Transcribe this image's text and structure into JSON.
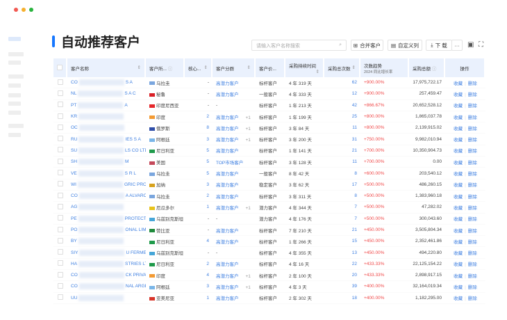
{
  "window": {
    "dots": [
      "#f25a52",
      "#f5b02e",
      "#29b33e"
    ]
  },
  "title": "自动推荐客户",
  "accent": "#1677ff",
  "toolbar": {
    "search_placeholder": "请输入客户名称搜索",
    "merge": "合并客户",
    "custom_cols": "自定义列",
    "download": "下 载",
    "more": "···",
    "icons": [
      "search-icon",
      "merge-icon",
      "columns-icon",
      "download-icon",
      "clipboard-icon",
      "fullscreen-icon"
    ]
  },
  "columns": [
    "客户名称",
    "客户所...",
    "核心...",
    "客户分群",
    "客户价...",
    "采购持续时间",
    "采购总次数",
    "次数趋势",
    "2024 同比增长率",
    "采购总额",
    "操作"
  ],
  "actions": {
    "fav": "收藏",
    "del": "删除"
  },
  "rows": [
    {
      "p": "CO",
      "s": "S A",
      "country": "乌拉圭",
      "flag": "#7aa6de",
      "core": "-",
      "group": "高潜力客户",
      "extra": "",
      "value": "标杆客户",
      "dur": "4 年 319 天",
      "cnt": "62",
      "trend": "+900.00%",
      "amt": "17,975,722.17"
    },
    {
      "p": "NL",
      "s": "S A C",
      "country": "秘鲁",
      "flag": "#d91f26",
      "core": "-",
      "group": "高潜力客户",
      "extra": "",
      "value": "一般客户",
      "dur": "4 年 333 天",
      "cnt": "12",
      "trend": "+900.00%",
      "amt": "257,459.47"
    },
    {
      "p": "PT",
      "s": "A",
      "country": "印度尼西亚",
      "flag": "#e5262a",
      "core": "-",
      "group": "-",
      "extra": "",
      "value": "标杆客户",
      "dur": "1 年 213 天",
      "cnt": "42",
      "trend": "+866.67%",
      "amt": "20,652,528.12"
    },
    {
      "p": "KR",
      "s": "",
      "country": "印度",
      "flag": "#f39a33",
      "core": "2",
      "group": "高潜力客户",
      "extra": "+1",
      "value": "标杆客户",
      "dur": "1 年 199 天",
      "cnt": "25",
      "trend": "+800.00%",
      "amt": "1,865,037.78"
    },
    {
      "p": "OC",
      "s": "",
      "country": "俄罗斯",
      "flag": "#2f4ea8",
      "core": "8",
      "group": "高潜力客户",
      "extra": "+1",
      "value": "标杆客户",
      "dur": "3 年 84 天",
      "cnt": "11",
      "trend": "+800.00%",
      "amt": "2,139,915.02"
    },
    {
      "p": "RU",
      "s": "IES S A",
      "country": "阿根廷",
      "flag": "#7ab6e8",
      "core": "3",
      "group": "高潜力客户",
      "extra": "+1",
      "value": "标杆客户",
      "dur": "3 年 200 天",
      "cnt": "31",
      "trend": "+750.00%",
      "amt": "9,982,010.94"
    },
    {
      "p": "SU",
      "s": "LS CO LTD",
      "country": "尼日利亚",
      "flag": "#1f9a4b",
      "core": "5",
      "group": "高潜力客户",
      "extra": "",
      "value": "标杆客户",
      "dur": "1 年 141 天",
      "cnt": "21",
      "trend": "+700.00%",
      "amt": "10,350,904.73"
    },
    {
      "p": "SH",
      "s": "M",
      "country": "美国",
      "flag": "#c4485a",
      "core": "5",
      "group": "TOP市场客户",
      "extra": "",
      "value": "标杆客户",
      "dur": "3 年 128 天",
      "cnt": "11",
      "trend": "+700.00%",
      "amt": "0.00"
    },
    {
      "p": "VE",
      "s": "S R L",
      "country": "乌拉圭",
      "flag": "#7aa6de",
      "core": "5",
      "group": "高潜力客户",
      "extra": "",
      "value": "一般客户",
      "dur": "8 年 42 天",
      "cnt": "8",
      "trend": "+600.00%",
      "amt": "203,540.12"
    },
    {
      "p": "WI",
      "s": "GRIC PRODU...",
      "country": "加纳",
      "flag": "#d7a21e",
      "core": "3",
      "group": "高潜力客户",
      "extra": "",
      "value": "稳定客户",
      "dur": "3 年 62 天",
      "cnt": "17",
      "trend": "+500.00%",
      "amt": "486,260.15"
    },
    {
      "p": "CO",
      "s": "A ALVARO RA...",
      "country": "乌拉圭",
      "flag": "#7aa6de",
      "core": "2",
      "group": "高潜力客户",
      "extra": "",
      "value": "标杆客户",
      "dur": "3 年 311 天",
      "cnt": "8",
      "trend": "+500.00%",
      "amt": "1,383,960.18"
    },
    {
      "p": "AG",
      "s": "",
      "country": "厄瓜多尔",
      "flag": "#e8c31c",
      "core": "1",
      "group": "高潜力客户",
      "extra": "+1",
      "value": "潜力客户",
      "dur": "4 年 344 天",
      "cnt": "7",
      "trend": "+500.00%",
      "amt": "47,282.02"
    },
    {
      "p": "PE",
      "s": "PROTECTION ...",
      "country": "乌兹别克斯坦",
      "flag": "#46a6d8",
      "core": "-",
      "group": "-",
      "extra": "",
      "value": "潜力客户",
      "dur": "4 年 176 天",
      "cnt": "7",
      "trend": "+500.00%",
      "amt": "300,043.60"
    },
    {
      "p": "PO",
      "s": "ONAL LIMITED",
      "country": "赞比亚",
      "flag": "#1f8a3c",
      "core": "-",
      "group": "高潜力客户",
      "extra": "",
      "value": "标杆客户",
      "dur": "7 年 210 天",
      "cnt": "21",
      "trend": "+450.00%",
      "amt": "3,505,804.34"
    },
    {
      "p": "BY",
      "s": "",
      "country": "尼日利亚",
      "flag": "#1f9a4b",
      "core": "4",
      "group": "高潜力客户",
      "extra": "",
      "value": "标杆客户",
      "dur": "1 年 266 天",
      "cnt": "15",
      "trend": "+450.00%",
      "amt": "2,352,461.86"
    },
    {
      "p": "SIY",
      "s": "U FERMER XO...",
      "country": "乌兹别克斯坦",
      "flag": "#46a6d8",
      "core": "-",
      "group": "-",
      "extra": "",
      "value": "标杆客户",
      "dur": "4 年 355 天",
      "cnt": "13",
      "trend": "+450.00%",
      "amt": "494,220.80"
    },
    {
      "p": "HA",
      "s": "STRIES LTD",
      "country": "尼日利亚",
      "flag": "#1f9a4b",
      "core": "2",
      "group": "高潜力客户",
      "extra": "",
      "value": "标杆客户",
      "dur": "4 年 16 天",
      "cnt": "22",
      "trend": "+433.33%",
      "amt": "22,125,154.22"
    },
    {
      "p": "CO",
      "s": "CK PRIVATE LI...",
      "country": "印度",
      "flag": "#f39a33",
      "core": "4",
      "group": "高潜力客户",
      "extra": "+1",
      "value": "标杆客户",
      "dur": "2 年 100 天",
      "cnt": "20",
      "trend": "+433.33%",
      "amt": "2,898,917.15"
    },
    {
      "p": "CO",
      "s": "NAL ARGENTI...",
      "country": "阿根廷",
      "flag": "#7ab6e8",
      "core": "3",
      "group": "高潜力客户",
      "extra": "+1",
      "value": "标杆客户",
      "dur": "4 年 3 天",
      "cnt": "39",
      "trend": "+400.00%",
      "amt": "32,164,019.34"
    },
    {
      "p": "UU",
      "s": "",
      "country": "亚美尼亚",
      "flag": "#d8352a",
      "core": "1",
      "group": "高潜力客户",
      "extra": "",
      "value": "标杆客户",
      "dur": "2 年 302 天",
      "cnt": "18",
      "trend": "+400.00%",
      "amt": "1,182,295.00"
    }
  ]
}
